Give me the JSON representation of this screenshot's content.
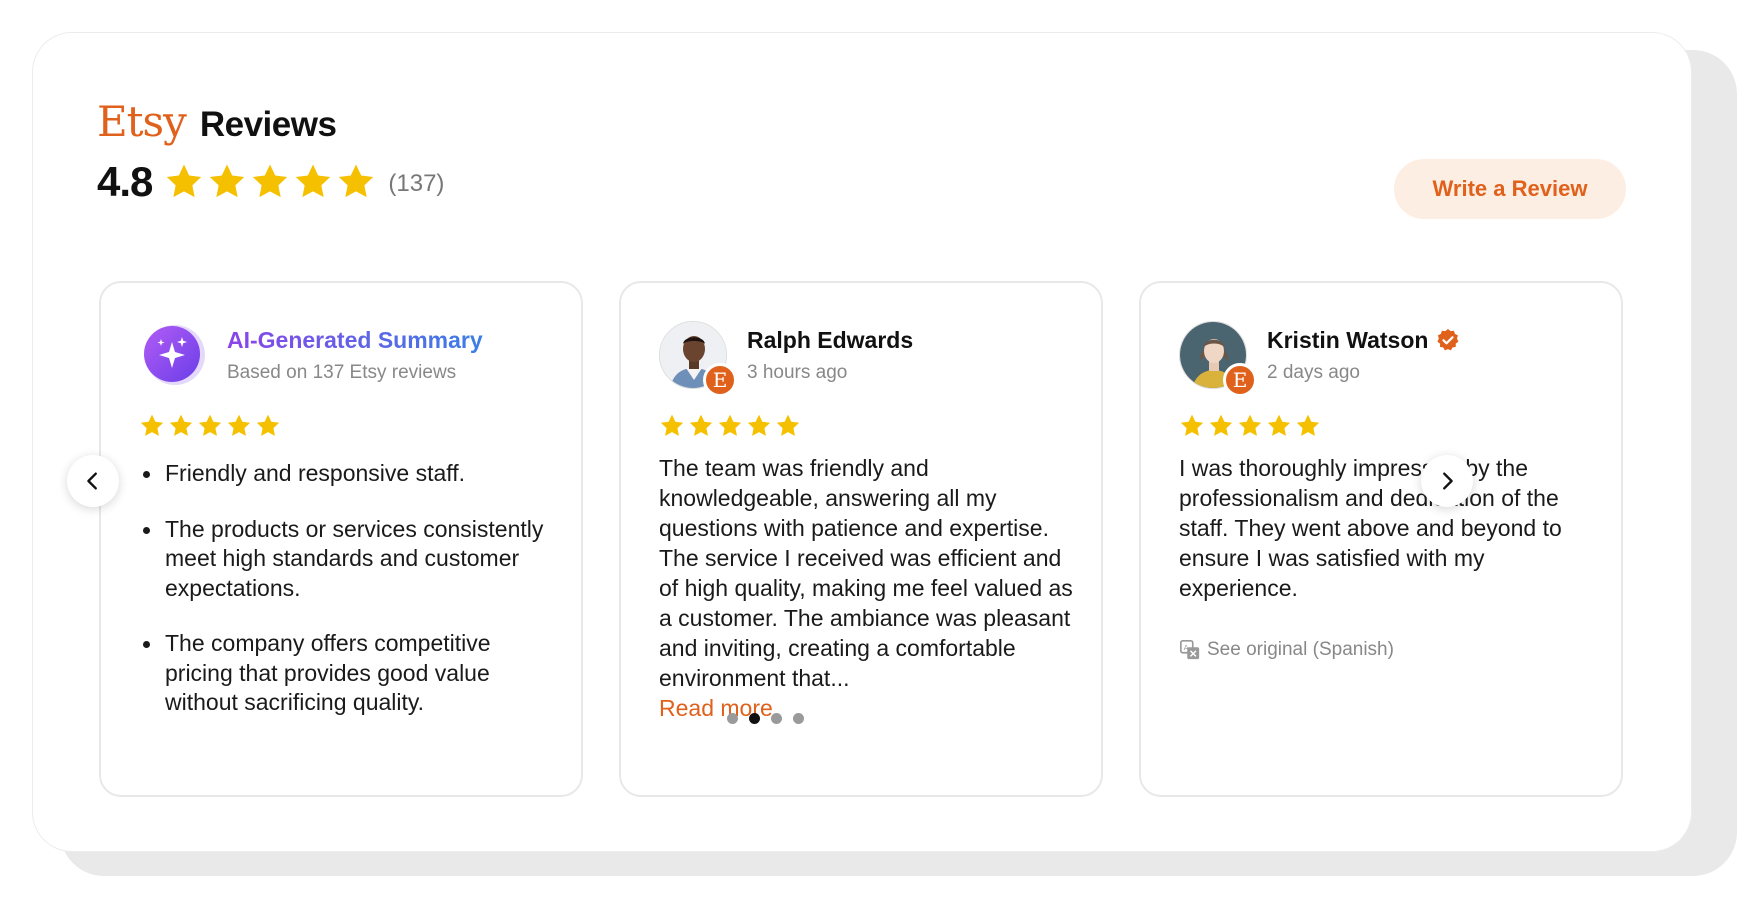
{
  "header": {
    "brand": "Etsy",
    "title": "Reviews",
    "rating": "4.8",
    "rating_stars": 5,
    "count": "(137)",
    "write_review_label": "Write a Review"
  },
  "colors": {
    "accent": "#e0611c",
    "star": "#f5c000",
    "ai_gradient_start": "#8b44e8",
    "ai_gradient_end": "#3a7fe6"
  },
  "summary_card": {
    "title": "AI-Generated Summary",
    "subtitle": "Based on 137 Etsy reviews",
    "stars": 5,
    "points": [
      "Friendly and responsive staff.",
      "The products or services consistently meet high standards and customer expectations.",
      "The company offers competitive pricing that provides good value without sacrificing quality."
    ]
  },
  "review_cards": [
    {
      "name": "Ralph Edwards",
      "time": "3 hours ago",
      "stars": 5,
      "verified": false,
      "text": "The team was friendly and knowledgeable, answering all my questions with patience and expertise. The service I received was efficient and of high quality, making me feel valued as a customer. The ambiance was pleasant and inviting, creating a comfortable environment that...",
      "read_more": "Read more"
    },
    {
      "name": "Kristin Watson",
      "time": "2 days ago",
      "stars": 5,
      "verified": true,
      "text": "I was thoroughly impressed by the professionalism and dedication of the staff. They went above and beyond to ensure I was satisfied with my experience.",
      "see_original": "See original (Spanish)"
    }
  ],
  "source_badge": "E",
  "icons": {
    "prev": "chevron-left-icon",
    "next": "chevron-right-icon",
    "verified": "verified-badge-icon",
    "translate": "translate-icon",
    "sparkle": "sparkle-icon"
  },
  "pagination": {
    "total": 4,
    "active": 2
  }
}
